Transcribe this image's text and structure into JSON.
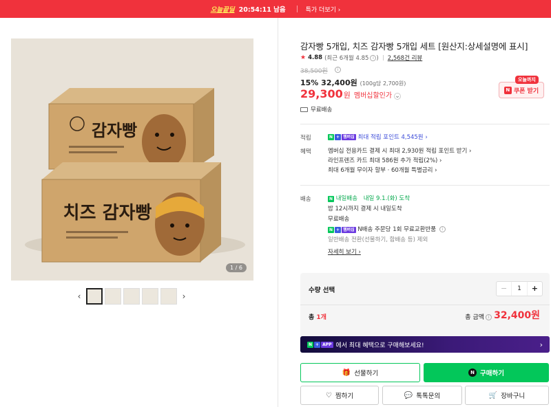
{
  "topbar": {
    "badge": "오늘끝딜",
    "countdown": "20:54:11 남음",
    "more": "특가 더보기 ›"
  },
  "gallery": {
    "counter": "1 / 6",
    "prev": "‹",
    "next": "›",
    "box1_text": "감자빵",
    "box2_text": "치즈 감자빵"
  },
  "product": {
    "title": "감자빵 5개입, 치즈 감자빵 5개입 세트 [원산지:상세설명에 표시]",
    "rating": "4.88",
    "recent_rating": "(최근 6개월 4.85",
    "reviews": "2,568건 리뷰",
    "original_price": "38,500원",
    "discount_line": "15% 32,400원",
    "unit_price": "(100g당 2,700원)",
    "member_price": "29,300",
    "member_won": "원",
    "member_label": "멤버십할인가",
    "shipping": "무료배송"
  },
  "coupon": {
    "badge": "오늘까지",
    "label": "쿠폰 받기"
  },
  "points": {
    "label": "적립",
    "text": "최대 적립 포인트 4,545원 ›"
  },
  "benefits": {
    "label": "혜택",
    "lines": [
      "멤버십 전용카드 결제 시 최대 2,930원 적립 포인트 받기 ›",
      "라인프렌즈 카드 최대 586원 추가 적립(2%) ›",
      "최대 6개월 무이자 할부 · 60개월 특별금리 ›"
    ]
  },
  "delivery": {
    "label": "배송",
    "tag": "내일배송",
    "arrival": "내일 9.1.(화) 도착",
    "cutoff": "밤 12시까지 결제 시 내일도착",
    "free": "무료배송",
    "return": "N배송 주문당 1회 무료교환반품",
    "exclude": "일반배송 전환(선물하기, 함배송 등) 제외",
    "more": "자세히 보기 ›"
  },
  "quantity": {
    "label": "수량 선택",
    "value": "1",
    "minus": "−",
    "plus": "+",
    "total_count_prefix": "총 ",
    "total_count": "1개",
    "amount_label": "총 금액",
    "amount": "32,400원"
  },
  "promo": {
    "text": "에서 최대 혜택으로 구매해보세요!",
    "chevron": "›"
  },
  "buttons": {
    "gift": "선물하기",
    "buy": "구매하기",
    "zzim": "찜하기",
    "talk": "톡톡문의",
    "cart": "장바구니"
  },
  "colors": {
    "brand_red": "#f0323c",
    "naver_green": "#03c75a"
  }
}
